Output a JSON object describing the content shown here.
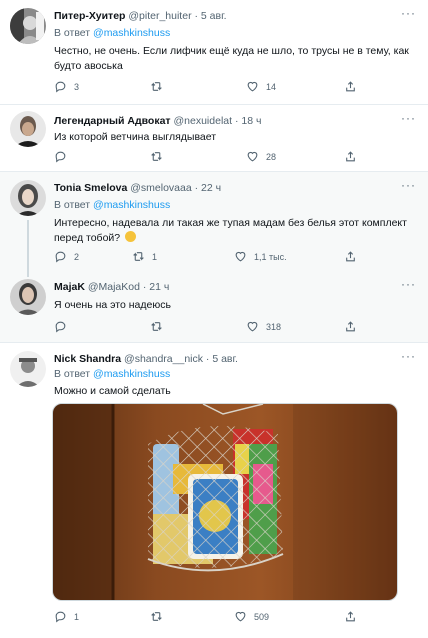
{
  "tweets": [
    {
      "name": "Питер-Хуитер",
      "handle": "@piter_huiter",
      "time": "· 5 авг.",
      "reply_prefix": "В ответ",
      "reply_handle": "@mashkinshuss",
      "text": "Честно, не очень. Если лифчик ещё куда не шло, то трусы не в тему, как будто авоська",
      "counts": {
        "reply": "3",
        "retweet": "",
        "like": "14"
      }
    },
    {
      "name": "Легендарный Адвокат",
      "handle": "@nexuidelat",
      "time": "· 18 ч",
      "text": "Из которой ветчина выглядывает",
      "counts": {
        "reply": "",
        "retweet": "",
        "like": "28"
      }
    },
    {
      "name": "Tonia Smelova",
      "handle": "@smelovaaa",
      "time": "· 22 ч",
      "reply_prefix": "В ответ",
      "reply_handle": "@mashkinshuss",
      "text": "Интересно, надевала ли такая же тупая мадам без белья этот комплект перед тобой?",
      "emoji": "thinking-face-emoji",
      "counts": {
        "reply": "2",
        "retweet": "1",
        "like": "1,1 тыс."
      }
    },
    {
      "name": "MajaK",
      "handle": "@MajaKod",
      "time": "· 21 ч",
      "text": "Я очень на это надеюсь",
      "counts": {
        "reply": "",
        "retweet": "",
        "like": "318"
      }
    },
    {
      "name": "Nick Shandra",
      "handle": "@shandra__nick",
      "time": "· 5 авг.",
      "reply_prefix": "В ответ",
      "reply_handle": "@mashkinshuss",
      "text": "Можно и самой сделать",
      "media": "photo of a string mesh bag hanging on a wooden door, holding a spread tub and food packages",
      "counts": {
        "reply": "1",
        "retweet": "",
        "like": "509"
      }
    }
  ],
  "more_glyph": "···",
  "icons": [
    "reply-icon",
    "retweet-icon",
    "like-icon",
    "share-icon",
    "more-icon"
  ],
  "colors": {
    "text": "#0f1419",
    "muted": "#536471",
    "link": "#1d9bf0",
    "highlight": "#f7f9f9",
    "divider": "#e6ecf0"
  }
}
